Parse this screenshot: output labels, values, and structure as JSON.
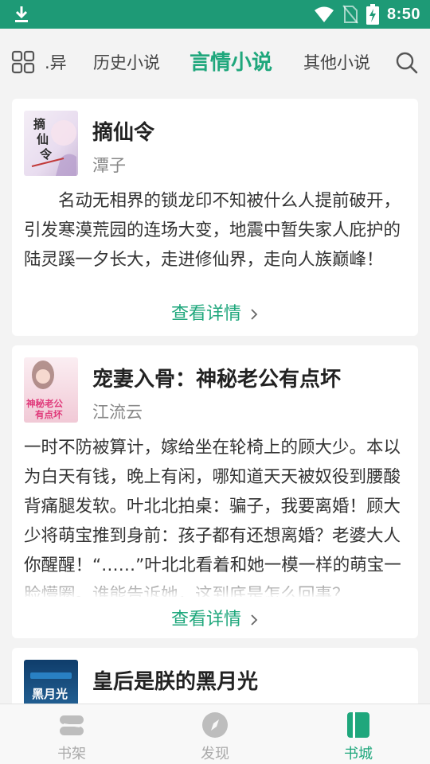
{
  "status_bar": {
    "time": "8:50",
    "icons": [
      "download-icon",
      "wifi-icon",
      "no-sim-icon",
      "battery-charging-icon"
    ]
  },
  "top_nav": {
    "tabs": [
      {
        "label": ".异",
        "active": false
      },
      {
        "label": "历史小说",
        "active": false
      },
      {
        "label": "言情小说",
        "active": true
      },
      {
        "label": "其他小说",
        "active": false
      }
    ],
    "left_icon": "grid-icon",
    "right_icon": "search-icon"
  },
  "books": [
    {
      "title": "摘仙令",
      "author": "潭子",
      "cover_text": "摘仙令",
      "description": "　　名动无相界的锁龙印不知被什么人提前破开，引发寒漠荒园的连场大变，地震中暂失家人庇护的陆灵蹊一夕长大，走进修仙界，走向人族巅峰！",
      "detail_label": "查看详情"
    },
    {
      "title": "宠妻入骨：神秘老公有点坏",
      "author": "江流云",
      "cover_text": "神秘老公有点坏",
      "description": " 一时不防被算计，嫁给坐在轮椅上的顾大少。本以为白天有钱，晚上有闲，哪知道天天被奴役到腰酸背痛腿发软。叶北北拍桌：骗子，我要离婚！顾大少将萌宝推到身前：孩子都有还想离婚？老婆大人你醒醒！“……”叶北北看着和她一模一样的萌宝一脸懵圈。谁能告诉她，这到底是怎么回事？",
      "detail_label": "查看详情"
    },
    {
      "title": "皇后是朕的黑月光",
      "author": "",
      "cover_text": "黑月光",
      "description": "",
      "detail_label": ""
    }
  ],
  "bottom_nav": [
    {
      "label": "书架",
      "icon": "bookshelf-icon",
      "active": false
    },
    {
      "label": "发现",
      "icon": "compass-icon",
      "active": false
    },
    {
      "label": "书城",
      "icon": "book-store-icon",
      "active": true
    }
  ],
  "colors": {
    "accent": "#1fa77c",
    "status_bar": "#1e9a76",
    "background": "#f3f3f3"
  }
}
